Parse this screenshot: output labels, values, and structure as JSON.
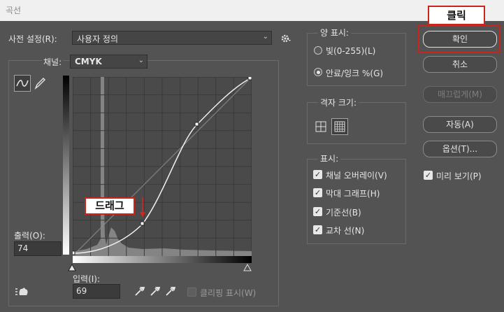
{
  "window": {
    "title": "곡선"
  },
  "preset": {
    "label": "사전 설정(R):",
    "value": "사용자 정의"
  },
  "channel": {
    "label": "채널:",
    "value": "CMYK"
  },
  "output": {
    "label": "출력(O):",
    "value": "74"
  },
  "input": {
    "label": "입력(I):",
    "value": "69"
  },
  "clipping": {
    "label": "클리핑 표시(W)"
  },
  "annotation": {
    "drag": "드래그",
    "click": "클릭"
  },
  "amount_display": {
    "title": "양 표시:",
    "options": [
      "빛(0-255)(L)",
      "안료/잉크 %(G)"
    ],
    "selected": 1
  },
  "grid_size": {
    "title": "격자 크기:"
  },
  "show": {
    "title": "표시:",
    "items": [
      "채널 오버레이(V)",
      "막대 그래프(H)",
      "기준선(B)",
      "교차 선(N)"
    ]
  },
  "buttons": {
    "ok": "확인",
    "cancel": "취소",
    "smooth": "매끄럽게(M)",
    "auto": "자동(A)",
    "options": "옵션(T)..."
  },
  "preview": {
    "label": "미리 보기(P)",
    "checked": true
  },
  "icons": [
    "gear-icon",
    "curve-tool-icon",
    "pencil-icon",
    "eyedropper-black-icon",
    "eyedropper-gray-icon",
    "eyedropper-white-icon",
    "targeted-adjustment-icon",
    "grid-coarse-icon",
    "grid-fine-icon",
    "arrow-down-icon"
  ],
  "colors": {
    "dialog_bg": "#535353",
    "callout_border": "#c8251c"
  }
}
